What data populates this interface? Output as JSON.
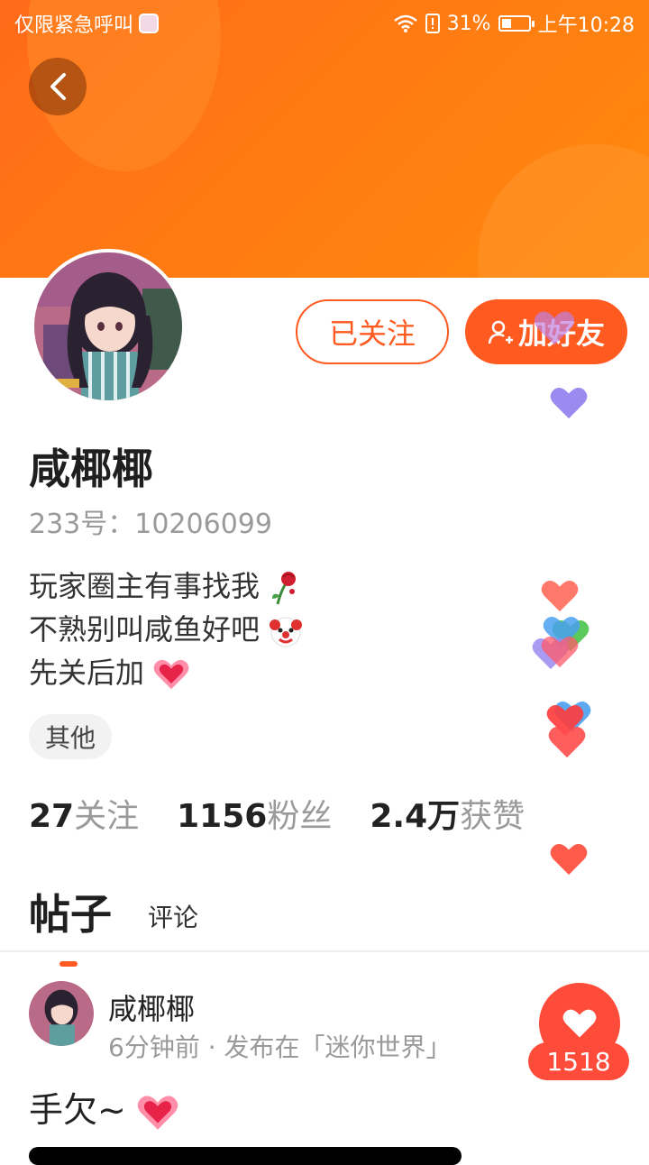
{
  "status_bar": {
    "left_text": "仅限紧急呼叫",
    "battery_percent": "31%",
    "battery_level": 0.31,
    "time": "上午10:28"
  },
  "profile": {
    "name": "咸椰椰",
    "id_text": "233号：10206099",
    "bio_lines": [
      "玩家圈主有事找我",
      "不熟别叫咸鱼好吧",
      "先关后加"
    ],
    "bio_emojis": [
      "wilted-rose-icon",
      "clown-face-icon",
      "sparkling-heart-icon"
    ],
    "tag": "其他",
    "buttons": {
      "following": "已关注",
      "add_friend": "加好友"
    }
  },
  "stats": [
    {
      "num": "27",
      "label": "关注"
    },
    {
      "num": "1156",
      "label": "粉丝"
    },
    {
      "num": "2.4万",
      "label": "获赞"
    }
  ],
  "tabs": {
    "active": "帖子",
    "inactive": "评论"
  },
  "post": {
    "author": "咸椰椰",
    "meta": "6分钟前 · 发布在「迷你世界」",
    "text": "手欠~",
    "likes": "1518"
  },
  "colors": {
    "accent": "#ff5a1f",
    "banner": "#ff7a12",
    "like": "#ff4b3a"
  }
}
